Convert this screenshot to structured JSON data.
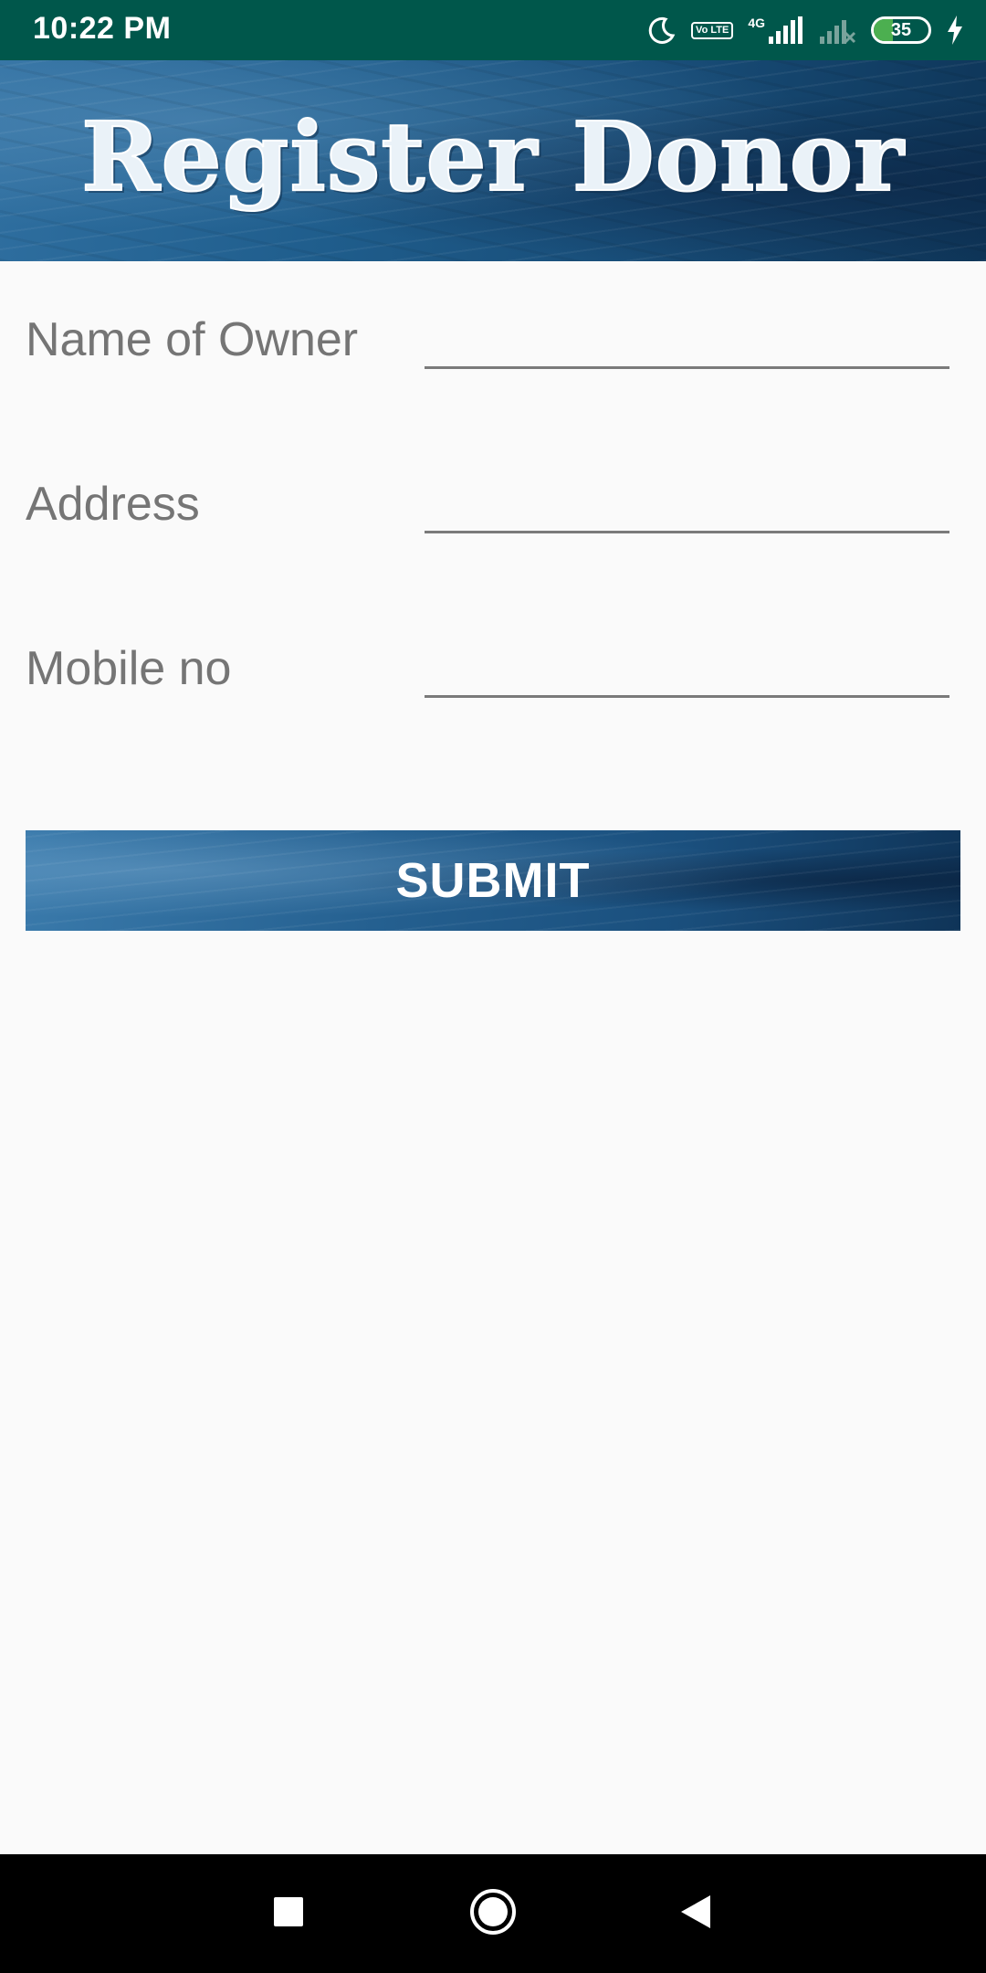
{
  "status_bar": {
    "time": "10:22 PM",
    "network_label": "4G",
    "volte_label": "Vo LTE",
    "battery_level": "35",
    "colors": {
      "background": "#00574b",
      "battery_fill": "#4caf50"
    },
    "icons": [
      "moon-icon",
      "volte-icon",
      "signal-icon",
      "signal-off-icon",
      "battery-icon",
      "charging-icon"
    ]
  },
  "header": {
    "title": "Register Donor"
  },
  "form": {
    "fields": [
      {
        "label": "Name of Owner",
        "value": ""
      },
      {
        "label": "Address",
        "value": ""
      },
      {
        "label": "Mobile no",
        "value": ""
      }
    ],
    "submit_label": "SUBMIT"
  },
  "nav_bar": {
    "icons": [
      "recents-icon",
      "home-icon",
      "back-icon"
    ]
  }
}
